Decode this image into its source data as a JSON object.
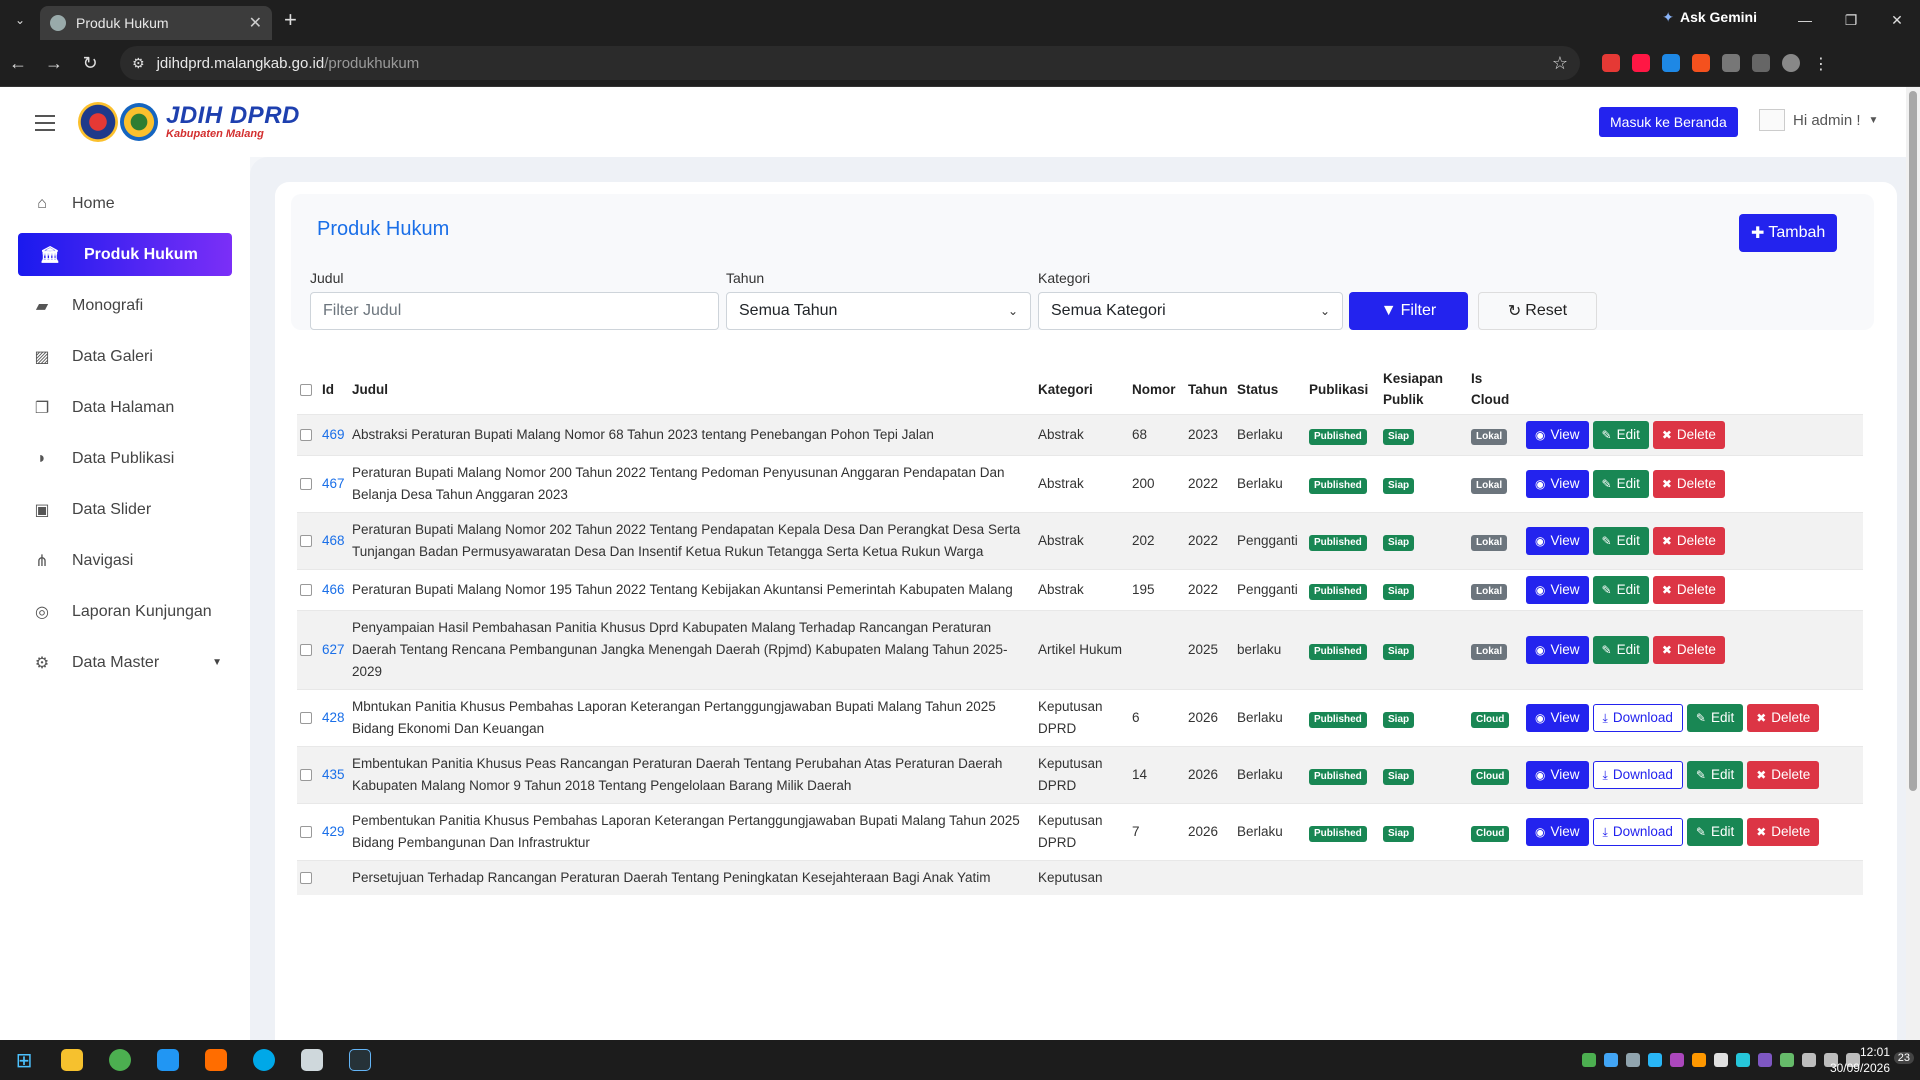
{
  "browser": {
    "tab_title": "Produk Hukum",
    "gemini_label": "Ask Gemini",
    "url_host": "jdihdprd.malangkab.go.id",
    "url_path": "/produkhukum"
  },
  "header": {
    "logo_title": "JDIH DPRD",
    "logo_subtitle": "Kabupaten Malang",
    "beranda_button": "Masuk ke Beranda",
    "user_greeting": "Hi admin !"
  },
  "sidebar": {
    "items": [
      {
        "label": "Home",
        "icon": "home-icon"
      },
      {
        "label": "Produk Hukum",
        "icon": "landmark-icon"
      },
      {
        "label": "Monografi",
        "icon": "book-icon"
      },
      {
        "label": "Data Galeri",
        "icon": "gallery-icon"
      },
      {
        "label": "Data Halaman",
        "icon": "pages-icon"
      },
      {
        "label": "Data Publikasi",
        "icon": "publication-icon"
      },
      {
        "label": "Data Slider",
        "icon": "slider-icon"
      },
      {
        "label": "Navigasi",
        "icon": "sitemap-icon"
      },
      {
        "label": "Laporan Kunjungan",
        "icon": "visit-icon"
      },
      {
        "label": "Data Master",
        "icon": "gear-icon"
      }
    ]
  },
  "page": {
    "title": "Produk Hukum",
    "add_button": "Tambah",
    "filter": {
      "judul_label": "Judul",
      "judul_placeholder": "Filter Judul",
      "tahun_label": "Tahun",
      "tahun_value": "Semua Tahun",
      "kategori_label": "Kategori",
      "kategori_value": "Semua Kategori",
      "filter_button": "Filter",
      "reset_button": "Reset"
    }
  },
  "table": {
    "headers": {
      "id": "Id",
      "judul": "Judul",
      "kategori": "Kategori",
      "nomor": "Nomor",
      "tahun": "Tahun",
      "status": "Status",
      "publikasi": "Publikasi",
      "kesiapan": "Kesiapan Publik",
      "cloud": "Is Cloud"
    },
    "actions": {
      "view": "View",
      "download": "Download",
      "edit": "Edit",
      "delete": "Delete"
    },
    "rows": [
      {
        "id": "469",
        "judul": "Abstraksi Peraturan Bupati Malang Nomor 68 Tahun 2023 tentang Penebangan Pohon Tepi Jalan",
        "kategori": "Abstrak",
        "nomor": "68",
        "tahun": "2023",
        "status": "Berlaku",
        "publikasi": "Published",
        "kesiapan": "Siap",
        "cloud": "Lokal"
      },
      {
        "id": "467",
        "judul": "Peraturan Bupati Malang Nomor 200 Tahun 2022 Tentang Pedoman Penyusunan Anggaran Pendapatan Dan Belanja Desa Tahun Anggaran 2023",
        "kategori": "Abstrak",
        "nomor": "200",
        "tahun": "2022",
        "status": "Berlaku",
        "publikasi": "Published",
        "kesiapan": "Siap",
        "cloud": "Lokal"
      },
      {
        "id": "468",
        "judul": "Peraturan Bupati Malang Nomor 202 Tahun 2022 Tentang Pendapatan Kepala Desa Dan Perangkat Desa Serta Tunjangan Badan Permusyawaratan Desa Dan Insentif Ketua Rukun Tetangga Serta Ketua Rukun Warga",
        "kategori": "Abstrak",
        "nomor": "202",
        "tahun": "2022",
        "status": "Pengganti",
        "publikasi": "Published",
        "kesiapan": "Siap",
        "cloud": "Lokal"
      },
      {
        "id": "466",
        "judul": "Peraturan Bupati Malang Nomor 195 Tahun 2022 Tentang Kebijakan Akuntansi Pemerintah Kabupaten Malang",
        "kategori": "Abstrak",
        "nomor": "195",
        "tahun": "2022",
        "status": "Pengganti",
        "publikasi": "Published",
        "kesiapan": "Siap",
        "cloud": "Lokal"
      },
      {
        "id": "627",
        "judul": "Penyampaian Hasil Pembahasan Panitia Khusus Dprd Kabupaten Malang Terhadap Rancangan Peraturan Daerah Tentang Rencana Pembangunan Jangka Menengah Daerah (Rpjmd) Kabupaten Malang Tahun 2025-2029",
        "kategori": "Artikel Hukum",
        "nomor": "",
        "tahun": "2025",
        "status": "berlaku",
        "publikasi": "Published",
        "kesiapan": "Siap",
        "cloud": "Lokal"
      },
      {
        "id": "428",
        "judul": "Mbntukan Panitia Khusus Pembahas Laporan Keterangan Pertanggungjawaban Bupati Malang Tahun 2025 Bidang Ekonomi Dan Keuangan",
        "kategori": "Keputusan DPRD",
        "nomor": "6",
        "tahun": "2026",
        "status": "Berlaku",
        "publikasi": "Published",
        "kesiapan": "Siap",
        "cloud": "Cloud"
      },
      {
        "id": "435",
        "judul": "Embentukan Panitia Khusus Peas Rancangan Peraturan Daerah Tentang Perubahan Atas Peraturan Daerah Kabupaten Malang Nomor 9 Tahun 2018 Tentang Pengelolaan Barang Milik Daerah",
        "kategori": "Keputusan DPRD",
        "nomor": "14",
        "tahun": "2026",
        "status": "Berlaku",
        "publikasi": "Published",
        "kesiapan": "Siap",
        "cloud": "Cloud"
      },
      {
        "id": "429",
        "judul": "Pembentukan Panitia Khusus Pembahas Laporan Keterangan Pertanggungjawaban Bupati Malang Tahun 2025 Bidang Pembangunan Dan Infrastruktur",
        "kategori": "Keputusan DPRD",
        "nomor": "7",
        "tahun": "2026",
        "status": "Berlaku",
        "publikasi": "Published",
        "kesiapan": "Siap",
        "cloud": "Cloud"
      },
      {
        "id": "",
        "judul": "Persetujuan Terhadap Rancangan Peraturan Daerah Tentang Peningkatan Kesejahteraan Bagi Anak Yatim",
        "kategori": "Keputusan",
        "nomor": "",
        "tahun": "",
        "status": "",
        "publikasi": "",
        "kesiapan": "",
        "cloud": ""
      }
    ]
  },
  "taskbar": {
    "time": "12:01",
    "date": "30/09/2026",
    "notifications": "23"
  }
}
